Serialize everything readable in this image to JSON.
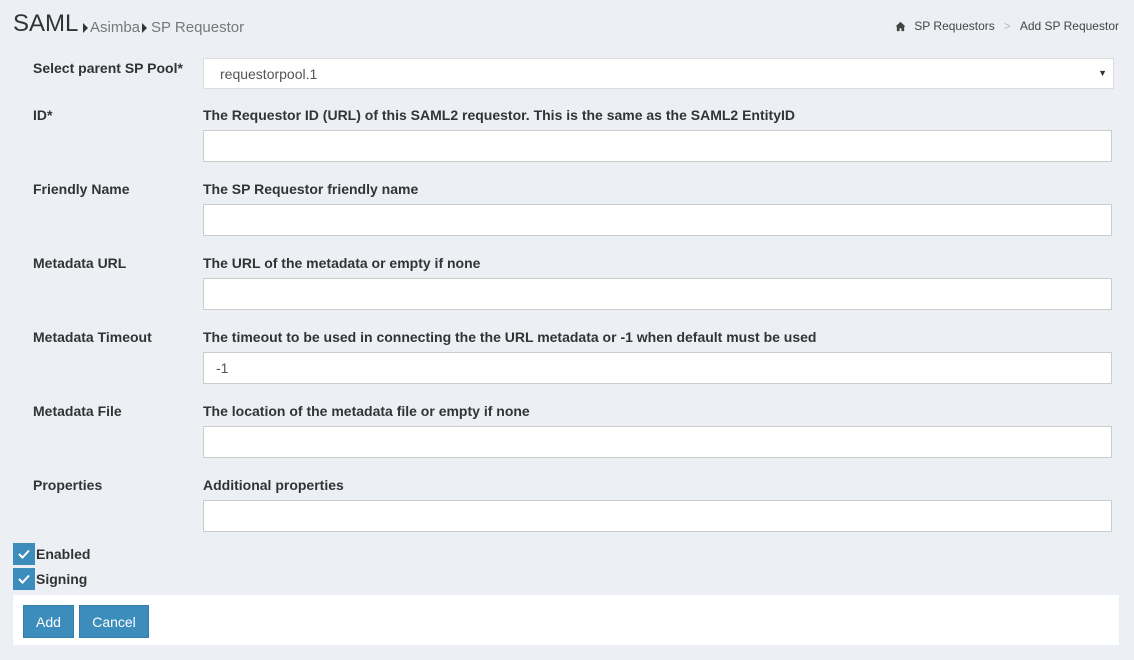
{
  "header": {
    "title": "SAML",
    "crumb1": "Asimba",
    "crumb2": "SP Requestor",
    "right_crumbs": [
      "SP Requestors",
      "Add SP Requestor"
    ],
    "separator": ">"
  },
  "form": {
    "pool": {
      "label": "Select parent SP Pool*",
      "selected": "requestorpool.1"
    },
    "id": {
      "label": "ID*",
      "help": "The Requestor ID (URL) of this SAML2 requestor. This is the same as the SAML2 EntityID",
      "value": ""
    },
    "friendly_name": {
      "label": "Friendly Name",
      "help": "The SP Requestor friendly name",
      "value": ""
    },
    "metadata_url": {
      "label": "Metadata URL",
      "help": "The URL of the metadata or empty if none",
      "value": ""
    },
    "metadata_timeout": {
      "label": "Metadata Timeout",
      "help": "The timeout to be used in connecting the the URL metadata or -1 when default must be used",
      "value": "-1"
    },
    "metadata_file": {
      "label": "Metadata File",
      "help": "The location of the metadata file or empty if none",
      "value": ""
    },
    "properties": {
      "label": "Properties",
      "help": "Additional properties",
      "value": ""
    },
    "enabled": {
      "label": "Enabled",
      "checked": true
    },
    "signing": {
      "label": "Signing",
      "checked": true
    }
  },
  "buttons": {
    "add": "Add",
    "cancel": "Cancel"
  },
  "colors": {
    "accent": "#3c8dbc",
    "background": "#ecf0f5"
  }
}
